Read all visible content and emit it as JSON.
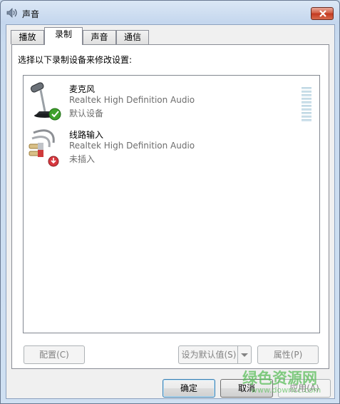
{
  "window": {
    "title": "声音"
  },
  "tabs": [
    {
      "label": "播放",
      "active": false
    },
    {
      "label": "录制",
      "active": true
    },
    {
      "label": "声音",
      "active": false
    },
    {
      "label": "通信",
      "active": false
    }
  ],
  "panel": {
    "prompt": "选择以下录制设备来修改设置:",
    "devices": [
      {
        "name": "麦克风",
        "driver": "Realtek High Definition Audio",
        "status": "默认设备",
        "icon": "microphone-icon",
        "badge": "default-check-icon"
      },
      {
        "name": "线路输入",
        "driver": "Realtek High Definition Audio",
        "status": "未插入",
        "icon": "line-in-cable-icon",
        "badge": "unplugged-icon"
      }
    ],
    "buttons": {
      "configure": "配置(C)",
      "set_default": "设为默认值(S)",
      "properties": "属性(P)"
    }
  },
  "footer": {
    "ok": "确定",
    "cancel": "取消",
    "apply": "应用(A)"
  },
  "watermark": {
    "text": "绿色资源网",
    "url": "www.downcc.com"
  }
}
